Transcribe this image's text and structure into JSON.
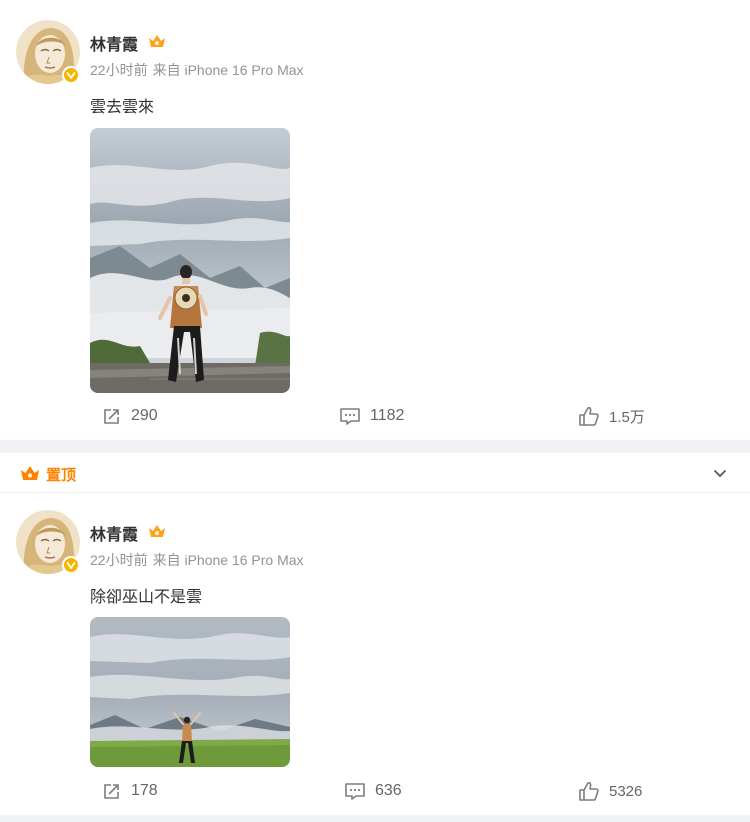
{
  "feed": {
    "posts": [
      {
        "author": "林青霞",
        "time": "22小时前",
        "source_prefix": "来自",
        "source": "iPhone 16 Pro Max",
        "text": "雲去雲來",
        "actions": {
          "repost": "290",
          "comment": "1182",
          "like": "1.5万"
        },
        "photo_icon": "tall-mountain-cloud-photo"
      },
      {
        "pinned_label": "置顶",
        "author": "林青霞",
        "time": "22小时前",
        "source_prefix": "来自",
        "source": "iPhone 16 Pro Max",
        "text": "除卻巫山不是雲",
        "actions": {
          "repost": "178",
          "comment": "636",
          "like": "5326"
        },
        "photo_icon": "wide-meadow-cloud-photo"
      }
    ]
  },
  "colors": {
    "accent_orange": "#ff8200",
    "verified_badge": "#f7b500",
    "meta_gray": "#939393",
    "action_gray": "#666666",
    "page_bg": "#f1f2f5"
  }
}
